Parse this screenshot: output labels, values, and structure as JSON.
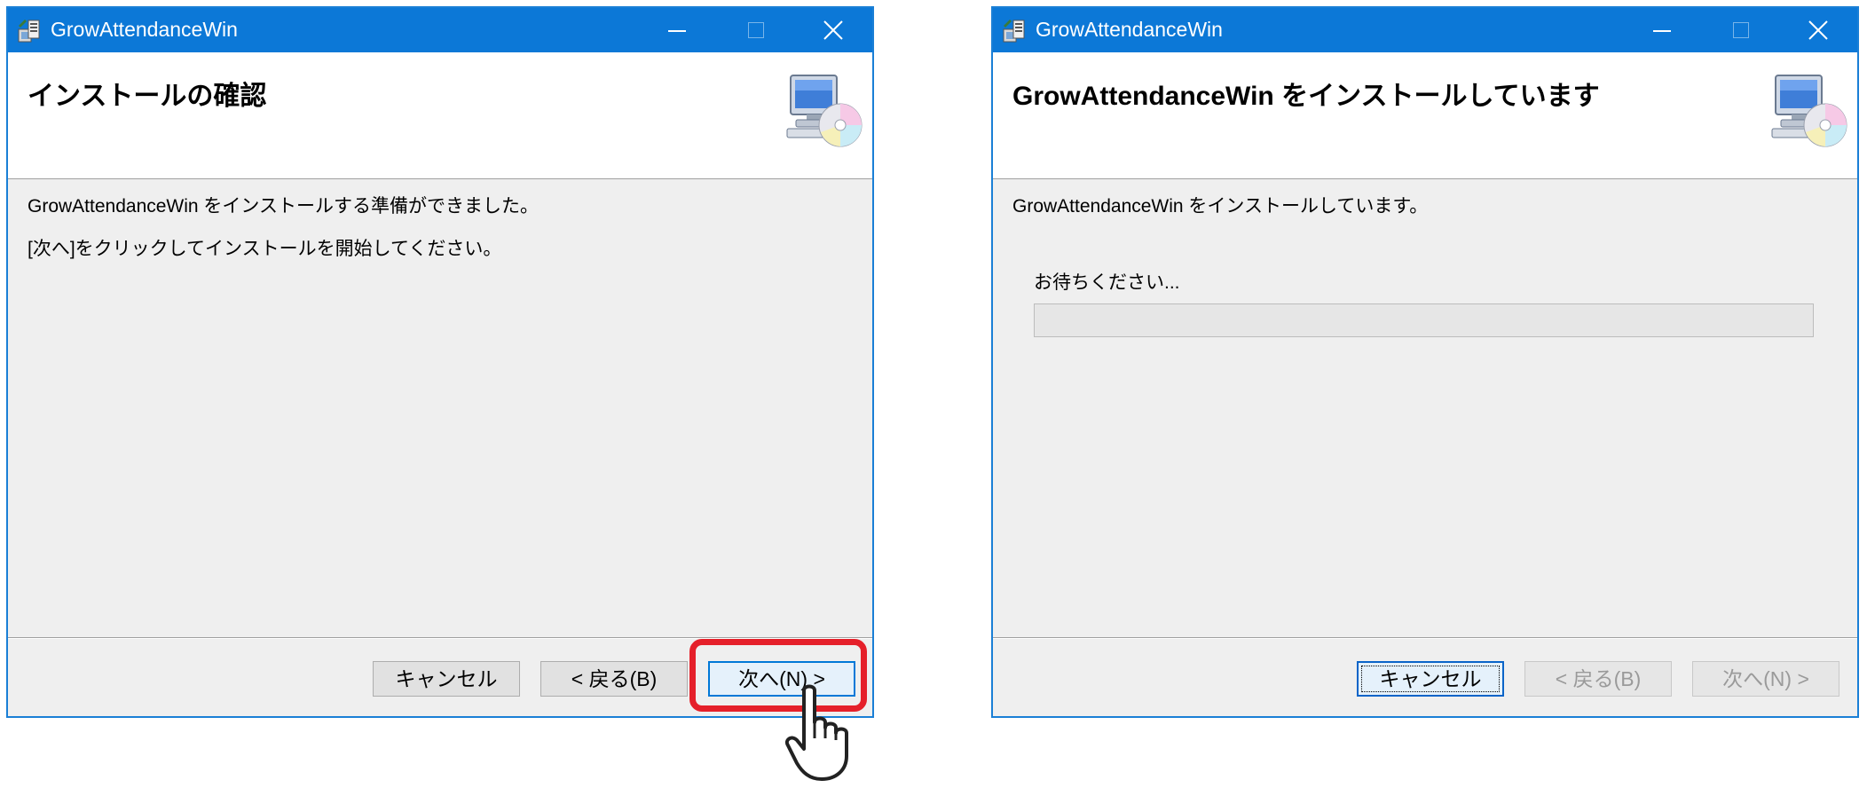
{
  "left_window": {
    "title": "GrowAttendanceWin",
    "header_title": "インストールの確認",
    "body_line1": "GrowAttendanceWin をインストールする準備ができました。",
    "body_line2": "[次へ]をクリックしてインストールを開始してください。",
    "buttons": {
      "cancel": "キャンセル",
      "back": "< 戻る(B)",
      "next": "次へ(N) >"
    }
  },
  "right_window": {
    "title": "GrowAttendanceWin",
    "header_title": "GrowAttendanceWin をインストールしています",
    "body_line1": "GrowAttendanceWin をインストールしています。",
    "progress_label": "お待ちください...",
    "progress_fraction": 0,
    "buttons": {
      "cancel": "キャンセル",
      "back": "< 戻る(B)",
      "next": "次へ(N) >"
    }
  },
  "colors": {
    "titlebar": "#0c78d7",
    "highlight": "#e5202a",
    "progress": "#06b025"
  },
  "icons": [
    "installer-app-icon",
    "computer-cd-icon",
    "minimize-icon",
    "maximize-icon",
    "close-icon",
    "pointing-hand-cursor-icon"
  ]
}
